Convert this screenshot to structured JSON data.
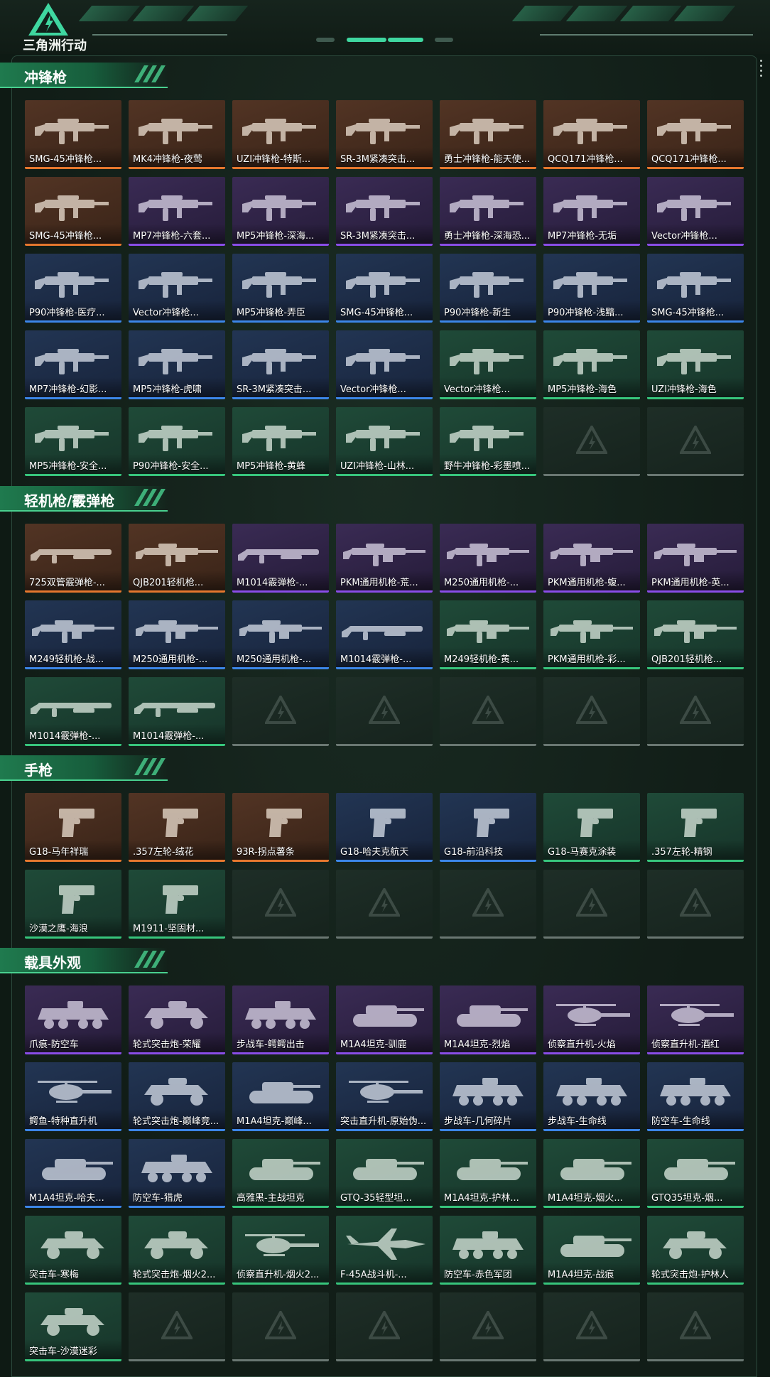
{
  "header": {
    "logo_text": "三角洲行动"
  },
  "colors": {
    "orange": "#e5772e",
    "purple": "#8a4de8",
    "blue": "#3c86e8",
    "green": "#37c57c",
    "accent": "#3fd7a0",
    "background": "#0e1a14"
  },
  "sections": [
    {
      "title": "冲锋枪",
      "items": [
        {
          "label": "SMG-45冲锋枪...",
          "rarity": "orange",
          "icon": "weapon-smg"
        },
        {
          "label": "MK4冲锋枪-夜莺",
          "rarity": "orange",
          "icon": "weapon-smg"
        },
        {
          "label": "UZI冲锋枪-特斯...",
          "rarity": "orange",
          "icon": "weapon-smg"
        },
        {
          "label": "SR-3M紧凑突击...",
          "rarity": "orange",
          "icon": "weapon-smg"
        },
        {
          "label": "勇士冲锋枪-能天使...",
          "rarity": "orange",
          "icon": "weapon-smg"
        },
        {
          "label": "QCQ171冲锋枪...",
          "rarity": "orange",
          "icon": "weapon-smg"
        },
        {
          "label": "QCQ171冲锋枪...",
          "rarity": "orange",
          "icon": "weapon-smg"
        },
        {
          "label": "SMG-45冲锋枪...",
          "rarity": "orange",
          "icon": "weapon-smg"
        },
        {
          "label": "MP7冲锋枪-六套...",
          "rarity": "purple",
          "icon": "weapon-smg"
        },
        {
          "label": "MP5冲锋枪-深海...",
          "rarity": "purple",
          "icon": "weapon-smg"
        },
        {
          "label": "SR-3M紧凑突击...",
          "rarity": "purple",
          "icon": "weapon-smg"
        },
        {
          "label": "勇士冲锋枪-深海恐...",
          "rarity": "purple",
          "icon": "weapon-smg"
        },
        {
          "label": "MP7冲锋枪-无垢",
          "rarity": "purple",
          "icon": "weapon-smg"
        },
        {
          "label": "Vector冲锋枪...",
          "rarity": "purple",
          "icon": "weapon-smg"
        },
        {
          "label": "P90冲锋枪-医疗...",
          "rarity": "blue",
          "icon": "weapon-smg"
        },
        {
          "label": "Vector冲锋枪...",
          "rarity": "blue",
          "icon": "weapon-smg"
        },
        {
          "label": "MP5冲锋枪-弄臣",
          "rarity": "blue",
          "icon": "weapon-smg"
        },
        {
          "label": "SMG-45冲锋枪...",
          "rarity": "blue",
          "icon": "weapon-smg"
        },
        {
          "label": "P90冲锋枪-新生",
          "rarity": "blue",
          "icon": "weapon-smg"
        },
        {
          "label": "P90冲锋枪-浅黯...",
          "rarity": "blue",
          "icon": "weapon-smg"
        },
        {
          "label": "SMG-45冲锋枪...",
          "rarity": "blue",
          "icon": "weapon-smg"
        },
        {
          "label": "MP7冲锋枪-幻影...",
          "rarity": "blue",
          "icon": "weapon-smg"
        },
        {
          "label": "MP5冲锋枪-虎啸",
          "rarity": "blue",
          "icon": "weapon-smg"
        },
        {
          "label": "SR-3M紧凑突击...",
          "rarity": "blue",
          "icon": "weapon-smg"
        },
        {
          "label": "Vector冲锋枪...",
          "rarity": "blue",
          "icon": "weapon-smg"
        },
        {
          "label": "Vector冲锋枪...",
          "rarity": "green",
          "icon": "weapon-smg"
        },
        {
          "label": "MP5冲锋枪-海色",
          "rarity": "green",
          "icon": "weapon-smg"
        },
        {
          "label": "UZI冲锋枪-海色",
          "rarity": "green",
          "icon": "weapon-smg"
        },
        {
          "label": "MP5冲锋枪-安全...",
          "rarity": "green",
          "icon": "weapon-smg"
        },
        {
          "label": "P90冲锋枪-安全...",
          "rarity": "green",
          "icon": "weapon-smg"
        },
        {
          "label": "MP5冲锋枪-黄蜂",
          "rarity": "green",
          "icon": "weapon-smg"
        },
        {
          "label": "UZI冲锋枪-山林...",
          "rarity": "green",
          "icon": "weapon-smg"
        },
        {
          "label": "野牛冲锋枪-彩墨喷...",
          "rarity": "green",
          "icon": "weapon-smg"
        },
        {
          "label": "",
          "rarity": "empty",
          "icon": ""
        },
        {
          "label": "",
          "rarity": "empty",
          "icon": ""
        }
      ]
    },
    {
      "title": "轻机枪/霰弹枪",
      "items": [
        {
          "label": "725双管霰弹枪-...",
          "rarity": "orange",
          "icon": "weapon-shotgun"
        },
        {
          "label": "QJB201轻机枪...",
          "rarity": "orange",
          "icon": "weapon-lmg"
        },
        {
          "label": "M1014霰弹枪-...",
          "rarity": "purple",
          "icon": "weapon-shotgun"
        },
        {
          "label": "PKM通用机枪-荒...",
          "rarity": "purple",
          "icon": "weapon-lmg"
        },
        {
          "label": "M250通用机枪-...",
          "rarity": "purple",
          "icon": "weapon-lmg"
        },
        {
          "label": "PKM通用机枪-蝮...",
          "rarity": "purple",
          "icon": "weapon-lmg"
        },
        {
          "label": "PKM通用机枪-英...",
          "rarity": "purple",
          "icon": "weapon-lmg"
        },
        {
          "label": "M249轻机枪-战...",
          "rarity": "blue",
          "icon": "weapon-lmg"
        },
        {
          "label": "M250通用机枪-...",
          "rarity": "blue",
          "icon": "weapon-lmg"
        },
        {
          "label": "M250通用机枪-...",
          "rarity": "blue",
          "icon": "weapon-lmg"
        },
        {
          "label": "M1014霰弹枪-...",
          "rarity": "blue",
          "icon": "weapon-shotgun"
        },
        {
          "label": "M249轻机枪-黄...",
          "rarity": "green",
          "icon": "weapon-lmg"
        },
        {
          "label": "PKM通用机枪-彩...",
          "rarity": "green",
          "icon": "weapon-lmg"
        },
        {
          "label": "QJB201轻机枪...",
          "rarity": "green",
          "icon": "weapon-lmg"
        },
        {
          "label": "M1014霰弹枪-...",
          "rarity": "green",
          "icon": "weapon-shotgun"
        },
        {
          "label": "M1014霰弹枪-...",
          "rarity": "green",
          "icon": "weapon-shotgun"
        },
        {
          "label": "",
          "rarity": "empty",
          "icon": ""
        },
        {
          "label": "",
          "rarity": "empty",
          "icon": ""
        },
        {
          "label": "",
          "rarity": "empty",
          "icon": ""
        },
        {
          "label": "",
          "rarity": "empty",
          "icon": ""
        },
        {
          "label": "",
          "rarity": "empty",
          "icon": ""
        }
      ]
    },
    {
      "title": "手枪",
      "items": [
        {
          "label": "G18-马年祥瑞",
          "rarity": "orange",
          "icon": "weapon-pistol"
        },
        {
          "label": ".357左轮-绒花",
          "rarity": "orange",
          "icon": "weapon-pistol"
        },
        {
          "label": "93R-拐点薯条",
          "rarity": "orange",
          "icon": "weapon-pistol"
        },
        {
          "label": "G18-哈夫克航天",
          "rarity": "blue",
          "icon": "weapon-pistol"
        },
        {
          "label": "G18-前沿科技",
          "rarity": "blue",
          "icon": "weapon-pistol"
        },
        {
          "label": "G18-马赛克涂装",
          "rarity": "green",
          "icon": "weapon-pistol"
        },
        {
          "label": ".357左轮-精钢",
          "rarity": "green",
          "icon": "weapon-pistol"
        },
        {
          "label": "沙漠之鹰-海浪",
          "rarity": "green",
          "icon": "weapon-pistol"
        },
        {
          "label": "M1911-坚固材...",
          "rarity": "green",
          "icon": "weapon-pistol"
        },
        {
          "label": "",
          "rarity": "empty",
          "icon": ""
        },
        {
          "label": "",
          "rarity": "empty",
          "icon": ""
        },
        {
          "label": "",
          "rarity": "empty",
          "icon": ""
        },
        {
          "label": "",
          "rarity": "empty",
          "icon": ""
        },
        {
          "label": "",
          "rarity": "empty",
          "icon": ""
        }
      ]
    },
    {
      "title": "载具外观",
      "items": [
        {
          "label": "爪痕-防空车",
          "rarity": "purple",
          "icon": "vehicle-apc"
        },
        {
          "label": "轮式突击炮-荣耀",
          "rarity": "purple",
          "icon": "vehicle-buggy"
        },
        {
          "label": "步战车-鳄鳄出击",
          "rarity": "purple",
          "icon": "vehicle-apc"
        },
        {
          "label": "M1A4坦克-驯鹿",
          "rarity": "purple",
          "icon": "vehicle-tank"
        },
        {
          "label": "M1A4坦克-烈焰",
          "rarity": "purple",
          "icon": "vehicle-tank"
        },
        {
          "label": "侦察直升机-火焰",
          "rarity": "purple",
          "icon": "vehicle-heli"
        },
        {
          "label": "侦察直升机-酒红",
          "rarity": "purple",
          "icon": "vehicle-heli"
        },
        {
          "label": "鳄鱼-特种直升机",
          "rarity": "blue",
          "icon": "vehicle-heli"
        },
        {
          "label": "轮式突击炮-巅峰竞...",
          "rarity": "blue",
          "icon": "vehicle-buggy"
        },
        {
          "label": "M1A4坦克-巅峰...",
          "rarity": "blue",
          "icon": "vehicle-tank"
        },
        {
          "label": "突击直升机-原始伪...",
          "rarity": "blue",
          "icon": "vehicle-heli"
        },
        {
          "label": "步战车-几何碎片",
          "rarity": "blue",
          "icon": "vehicle-apc"
        },
        {
          "label": "步战车-生命线",
          "rarity": "blue",
          "icon": "vehicle-apc"
        },
        {
          "label": "防空车-生命线",
          "rarity": "blue",
          "icon": "vehicle-apc"
        },
        {
          "label": "M1A4坦克-哈夫...",
          "rarity": "blue",
          "icon": "vehicle-tank"
        },
        {
          "label": "防空车-猎虎",
          "rarity": "blue",
          "icon": "vehicle-apc"
        },
        {
          "label": "高雅黑-主战坦克",
          "rarity": "green",
          "icon": "vehicle-tank"
        },
        {
          "label": "GTQ-35轻型坦...",
          "rarity": "green",
          "icon": "vehicle-tank"
        },
        {
          "label": "M1A4坦克-护林...",
          "rarity": "green",
          "icon": "vehicle-tank"
        },
        {
          "label": "M1A4坦克-烟火...",
          "rarity": "green",
          "icon": "vehicle-tank"
        },
        {
          "label": "GTQ35坦克-烟...",
          "rarity": "green",
          "icon": "vehicle-tank"
        },
        {
          "label": "突击车-寒梅",
          "rarity": "green",
          "icon": "vehicle-buggy"
        },
        {
          "label": "轮式突击炮-烟火2...",
          "rarity": "green",
          "icon": "vehicle-buggy"
        },
        {
          "label": "侦察直升机-烟火2...",
          "rarity": "green",
          "icon": "vehicle-heli"
        },
        {
          "label": "F-45A战斗机-...",
          "rarity": "green",
          "icon": "vehicle-jet"
        },
        {
          "label": "防空车-赤色军团",
          "rarity": "green",
          "icon": "vehicle-apc"
        },
        {
          "label": "M1A4坦克-战痕",
          "rarity": "green",
          "icon": "vehicle-tank"
        },
        {
          "label": "轮式突击炮-护林人",
          "rarity": "green",
          "icon": "vehicle-buggy"
        },
        {
          "label": "突击车-沙漠迷彩",
          "rarity": "green",
          "icon": "vehicle-buggy"
        },
        {
          "label": "",
          "rarity": "empty",
          "icon": ""
        },
        {
          "label": "",
          "rarity": "empty",
          "icon": ""
        },
        {
          "label": "",
          "rarity": "empty",
          "icon": ""
        },
        {
          "label": "",
          "rarity": "empty",
          "icon": ""
        },
        {
          "label": "",
          "rarity": "empty",
          "icon": ""
        },
        {
          "label": "",
          "rarity": "empty",
          "icon": ""
        }
      ]
    }
  ]
}
